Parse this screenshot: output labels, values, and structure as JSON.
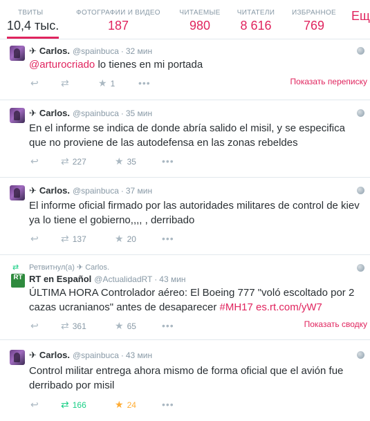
{
  "stats": [
    {
      "label": "ТВИТЫ",
      "value": "10,4 тыс."
    },
    {
      "label": "ФОТОГРАФИИ И ВИДЕО",
      "value": "187"
    },
    {
      "label": "ЧИТАЕМЫЕ",
      "value": "980"
    },
    {
      "label": "ЧИТАТЕЛИ",
      "value": "8 616"
    },
    {
      "label": "ИЗБРАННОЕ",
      "value": "769"
    },
    {
      "label": "",
      "value": "Ещ"
    }
  ],
  "tweets": [
    {
      "name": "Carlos.",
      "handle": "@spainbuca",
      "time": "32 мин",
      "mention": "@arturocriado",
      "text": " lo tienes en mi portada",
      "retweets": "",
      "favorites": "1",
      "expand": "Показать переписку"
    },
    {
      "name": "Carlos.",
      "handle": "@spainbuca",
      "time": "35 мин",
      "text": "En el informe se indica de donde abría salido el misil, y se especifica que no proviene de las autodefensa en las zonas rebeldes",
      "retweets": "227",
      "favorites": "35"
    },
    {
      "name": "Carlos.",
      "handle": "@spainbuca",
      "time": "37 мин",
      "text": "El informe oficial firmado  por las autoridades militares de control de kiev ya lo tiene el gobierno,,,, , derribado",
      "retweets": "137",
      "favorites": "20"
    },
    {
      "retweeted_by": "Ретвитнул(а) ✈ Carlos.",
      "avatar_text": "RT",
      "name": "RT en Español",
      "handle": "@ActualidadRT",
      "time": "43 мин",
      "text": "ÚLTIMA HORA Controlador aéreo: El Boeing 777 \"voló escoltado por 2 cazas ucranianos\" antes de desaparecer ",
      "hashtag": "#MH17",
      "link": "es.rt.com/yW7",
      "retweets": "361",
      "favorites": "65",
      "expand": "Показать сводку"
    },
    {
      "name": "Carlos.",
      "handle": "@spainbuca",
      "time": "43 мин",
      "text": "Control militar entrega ahora mismo de forma oficial que el avión fue derribado por misil",
      "retweets": "166",
      "favorites": "24"
    }
  ],
  "icons": {
    "plane": "✈",
    "reply": "↩",
    "retweet": "⇄",
    "favorite": "★",
    "more": "•••",
    "separator": "·"
  },
  "colors": {
    "accent": "#e0245e",
    "retweet_active": "#19cf86",
    "favorite_active": "#ffac33",
    "muted": "#8899a6"
  }
}
